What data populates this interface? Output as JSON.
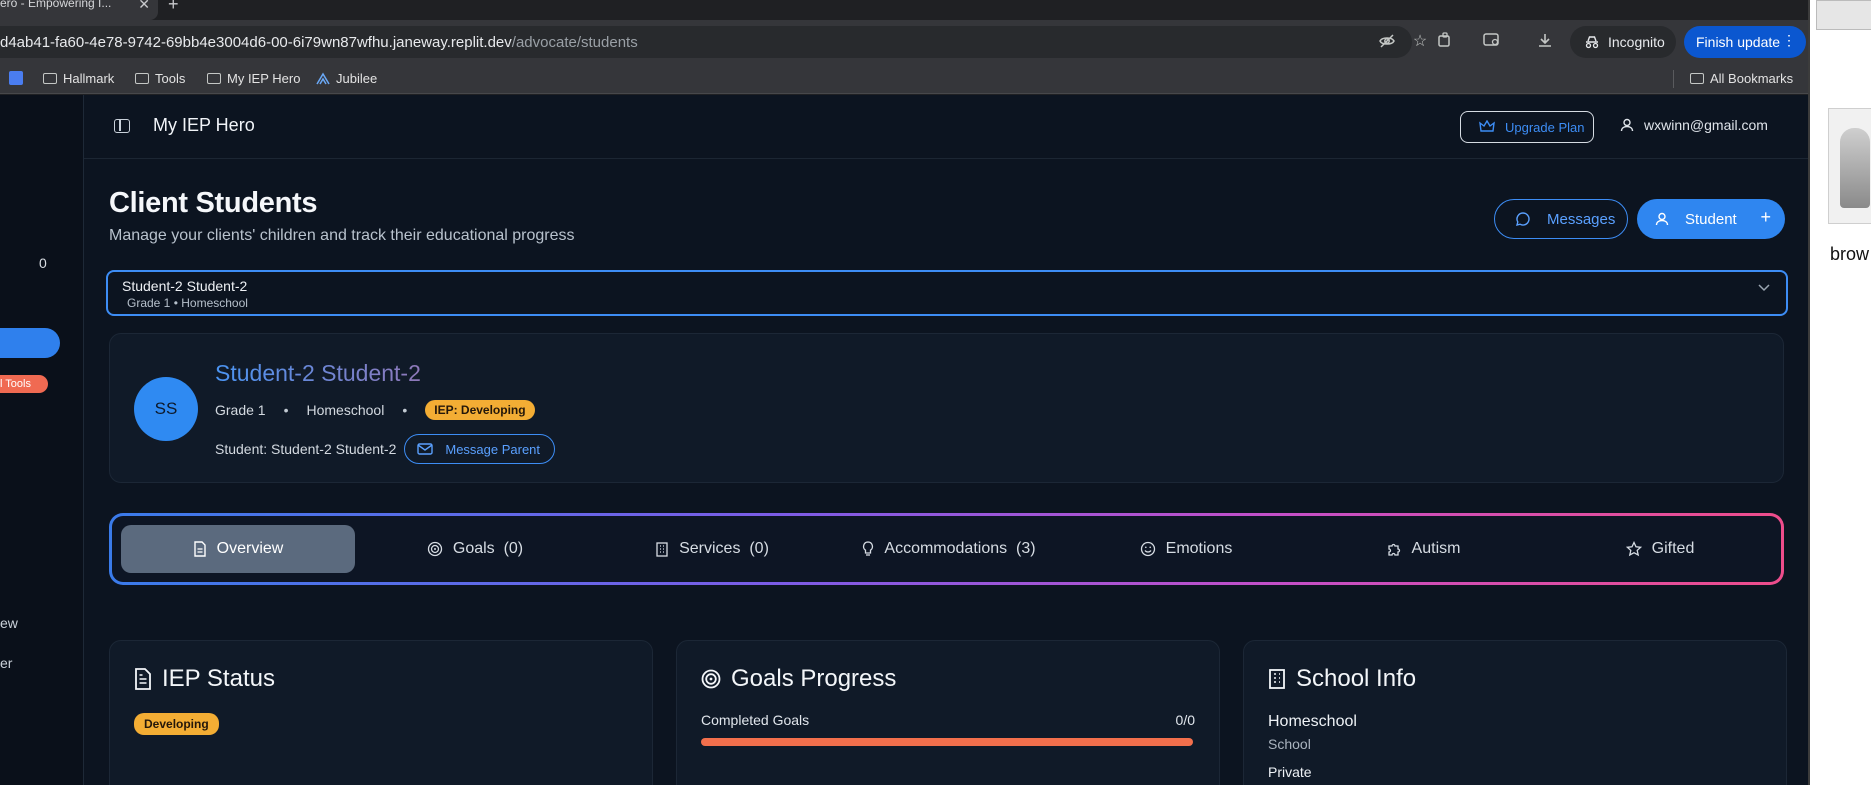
{
  "browser": {
    "tab_title": "ero - Empowering I...",
    "url_host": "d4ab41-fa60-4e78-9742-69bb4e3004d6-00-6i79wn87wfhu.janeway.replit.dev",
    "url_path": "/advocate/students",
    "incognito_label": "Incognito",
    "finish_update_label": "Finish update",
    "bookmarks": [
      {
        "label": "Hallmark",
        "icon": "folder-icon"
      },
      {
        "label": "Tools",
        "icon": "folder-icon"
      },
      {
        "label": "My IEP Hero",
        "icon": "folder-icon"
      },
      {
        "label": "Jubilee",
        "icon": "jubilee-icon"
      }
    ],
    "all_bookmarks_label": "All Bookmarks"
  },
  "side_window": {
    "label": "brow"
  },
  "sidebar": {
    "count": "0",
    "badge": "l Tools",
    "items": [
      "ew",
      "er"
    ]
  },
  "header": {
    "app_title": "My IEP Hero",
    "upgrade_label": "Upgrade Plan",
    "user_email": "wxwinn@gmail.com"
  },
  "page": {
    "title": "Client Students",
    "subtitle": "Manage your clients' children and track their educational progress",
    "messages_label": "Messages",
    "student_label": "Student"
  },
  "selector": {
    "name": "Student-2 Student-2",
    "meta": "Grade 1 • Homeschool"
  },
  "student": {
    "initials": "SS",
    "name": "Student-2 Student-2",
    "grade": "Grade 1",
    "school": "Homeschool",
    "iep_badge": "IEP: Developing",
    "student_line": "Student: Student-2 Student-2",
    "message_parent_label": "Message Parent"
  },
  "tabs": [
    {
      "label": "Overview",
      "icon": "document-icon",
      "active": true
    },
    {
      "label": "Goals  (0)",
      "icon": "target-icon",
      "active": false
    },
    {
      "label": "Services  (0)",
      "icon": "building-icon",
      "active": false
    },
    {
      "label": "Accommodations  (3)",
      "icon": "lightbulb-icon",
      "active": false
    },
    {
      "label": "Emotions",
      "icon": "smile-icon",
      "active": false
    },
    {
      "label": "Autism",
      "icon": "puzzle-icon",
      "active": false
    },
    {
      "label": "Gifted",
      "icon": "star-icon",
      "active": false
    }
  ],
  "cards": {
    "iep_status": {
      "title": "IEP Status",
      "badge": "Developing"
    },
    "goals_progress": {
      "title": "Goals Progress",
      "label": "Completed Goals",
      "value": "0/0",
      "completed": 0
    },
    "school_info": {
      "title": "School Info",
      "school_name": "Homeschool",
      "school_label": "School",
      "type": "Private"
    }
  },
  "colors": {
    "accent": "#2f86f0",
    "warning": "#f3ad34",
    "progress_track": "#f26f4c",
    "background": "#0c1420"
  }
}
